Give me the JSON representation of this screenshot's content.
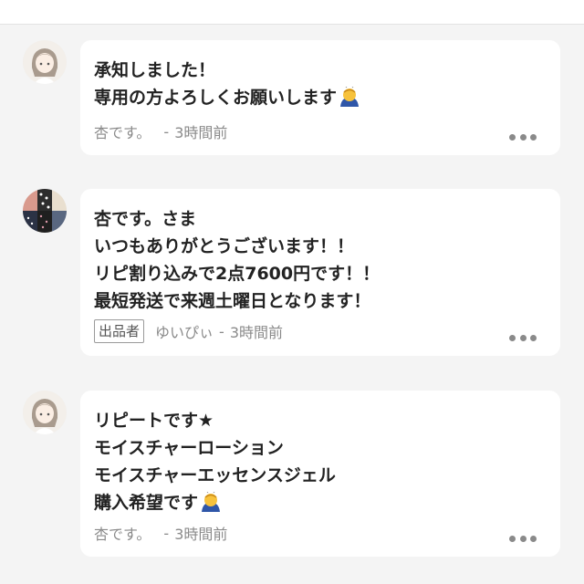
{
  "comments": [
    {
      "avatar_icon": "girl-avatar-icon",
      "lines": [
        "承知しました！",
        "専用の方よろしくお願いします"
      ],
      "emoji_icon": "bowing-person-emoji-icon",
      "author": "杏です。",
      "separator": "-",
      "time": "3時間前"
    },
    {
      "avatar_icon": "pattern-avatar-icon",
      "lines": [
        "杏です。さま",
        "いつもありがとうございます！！",
        "リピ割り込みで2点7600円です！！",
        "最短発送で来週土曜日となります！"
      ],
      "badge": "出品者",
      "author": "ゆいぴぃ",
      "separator": "-",
      "time": "3時間前"
    },
    {
      "avatar_icon": "girl-avatar-icon",
      "lines": [
        "リピートです★",
        "モイスチャーローション",
        "モイスチャーエッセンスジェル",
        "購入希望です"
      ],
      "emoji_icon": "bowing-person-emoji-icon",
      "author": "杏です。",
      "separator": "-",
      "time": "3時間前"
    }
  ],
  "more_icon": "more-options-icon"
}
